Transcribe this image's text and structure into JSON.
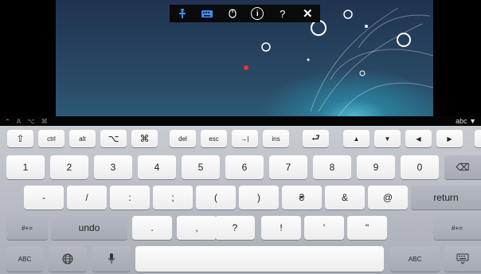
{
  "session_toolbar": {
    "pin_icon": "pin-icon",
    "keyboard_icon": "keyboard-icon",
    "mouse_icon": "mouse-icon",
    "info": "i",
    "help": "?",
    "close": "✕"
  },
  "modifier_bar": {
    "letters": "⌃ A ⌥ ⌘",
    "mode": "abc ▼"
  },
  "keyboard": {
    "top_row": [
      "⇧",
      "ctrl",
      "alt",
      "⌥",
      "⌘",
      "del",
      "esc",
      "→|",
      "ins",
      "⮐",
      "▲",
      "▼",
      "◀",
      "▶"
    ],
    "number_row": [
      "1",
      "2",
      "3",
      "4",
      "5",
      "6",
      "7",
      "8",
      "9",
      "0",
      "⌫"
    ],
    "symbol_row": [
      "-",
      "/",
      ":",
      ";",
      "(",
      ")",
      "₴",
      "&",
      "@",
      "return"
    ],
    "punct_row": [
      "#+=",
      "undo",
      ".",
      ",",
      "?",
      "!",
      "'",
      "\"",
      "#+="
    ],
    "bottom_row": {
      "abc_left": "ABC",
      "globe": "🌐",
      "mic": "🎤",
      "abc_right": "ABC",
      "hide": "⌨"
    }
  }
}
